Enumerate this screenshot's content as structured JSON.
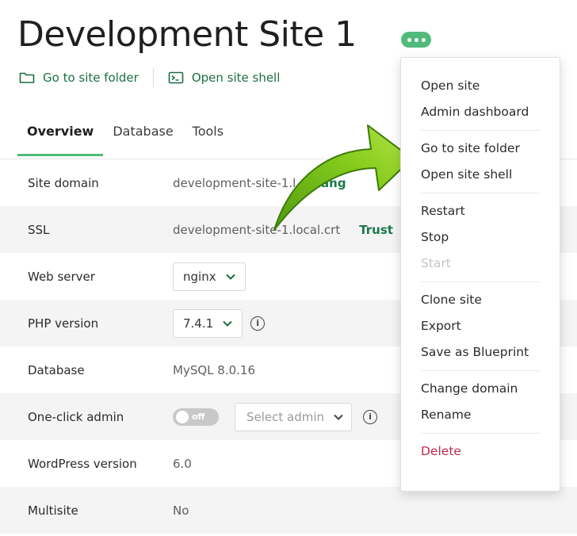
{
  "header": {
    "title": "Development Site 1",
    "more_icon": "ellipsis-icon"
  },
  "quick_actions": [
    {
      "icon": "folder-icon",
      "label": "Go to site folder"
    },
    {
      "icon": "terminal-icon",
      "label": "Open site shell"
    }
  ],
  "tabs": [
    {
      "label": "Overview",
      "active": true
    },
    {
      "label": "Database",
      "active": false
    },
    {
      "label": "Tools",
      "active": false
    }
  ],
  "rows": {
    "site_domain": {
      "label": "Site domain",
      "value": "development-site-1.l",
      "action": "Chang"
    },
    "ssl": {
      "label": "SSL",
      "value": "development-site-1.local.crt",
      "action": "Trust"
    },
    "web_server": {
      "label": "Web server",
      "value": "nginx"
    },
    "php_version": {
      "label": "PHP version",
      "value": "7.4.1"
    },
    "database": {
      "label": "Database",
      "value": "MySQL 8.0.16"
    },
    "one_click_admin": {
      "label": "One-click admin",
      "toggle": "off",
      "select_placeholder": "Select admin"
    },
    "wordpress_version": {
      "label": "WordPress version",
      "value": "6.0"
    },
    "multisite": {
      "label": "Multisite",
      "value": "No"
    }
  },
  "menu": {
    "groups": [
      [
        "Open site",
        "Admin dashboard"
      ],
      [
        "Go to site folder",
        "Open site shell"
      ],
      [
        "Restart",
        "Stop",
        "Start"
      ],
      [
        "Clone site",
        "Export",
        "Save as Blueprint"
      ],
      [
        "Change domain",
        "Rename"
      ],
      [
        "Delete"
      ]
    ],
    "disabled_items": [
      "Start"
    ],
    "danger_items": [
      "Delete"
    ]
  },
  "colors": {
    "accent": "#51bb7b",
    "link": "#1a7a4a",
    "danger": "#c0294e",
    "arrow": "#7cc217"
  }
}
